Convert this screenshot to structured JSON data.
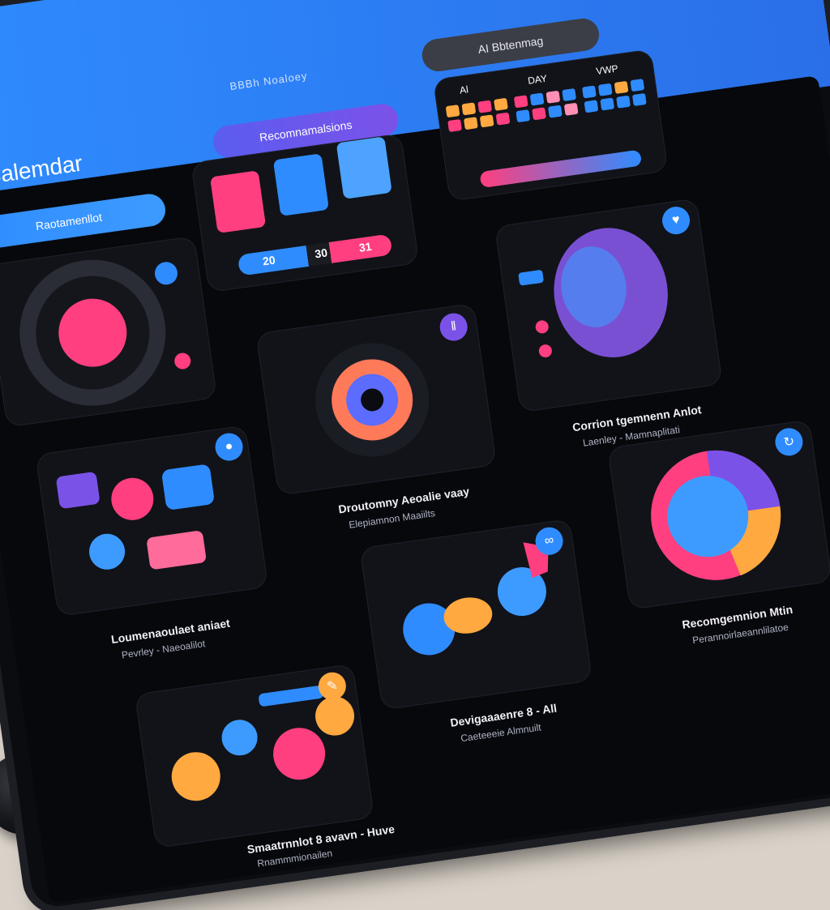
{
  "app": {
    "title": "Calemdar",
    "top_tab": "BBBh Noaloey"
  },
  "pills": {
    "main": "Raotamenllot",
    "recommendations": "Recomnamalsions",
    "ai": "AI Bbtenmag"
  },
  "calendar": {
    "views": [
      "Al",
      "DAY",
      "VWP"
    ]
  },
  "date_strip": [
    "20",
    "30",
    "31"
  ],
  "cards": [
    {
      "caption": "Loumenaoulaet aniaet",
      "subcaption": "Pevrley - Naeoalilot"
    },
    {
      "caption": "Droutomny Aeoalie vaay",
      "subcaption": "Elepiamnon Maaiilts"
    },
    {
      "caption": "Corrion tgemnenn Anlot",
      "subcaption": "Laenley - Mamnaplitati"
    },
    {
      "caption": "Devigaaaenre 8 - All",
      "subcaption": "Caeteeeie Almnuilt"
    },
    {
      "caption": "Recomgemnion Mtin",
      "subcaption": "Perannoirlaeannlilatoe"
    },
    {
      "caption": "Smaatrnnlot 8 avavn - Huve",
      "subcaption": "Rnammmionailen"
    }
  ],
  "colors": {
    "accent_blue": "#2f8cff",
    "accent_pink": "#ff3f7f",
    "accent_orange": "#ffa940",
    "accent_violet": "#7b52e8"
  }
}
